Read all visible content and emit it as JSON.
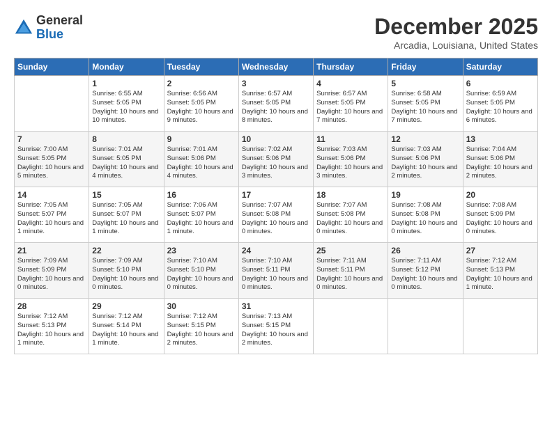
{
  "header": {
    "logo_general": "General",
    "logo_blue": "Blue",
    "month": "December 2025",
    "location": "Arcadia, Louisiana, United States"
  },
  "days_of_week": [
    "Sunday",
    "Monday",
    "Tuesday",
    "Wednesday",
    "Thursday",
    "Friday",
    "Saturday"
  ],
  "weeks": [
    [
      {
        "day": "",
        "empty": true
      },
      {
        "day": "1",
        "sunrise": "Sunrise: 6:55 AM",
        "sunset": "Sunset: 5:05 PM",
        "daylight": "Daylight: 10 hours and 10 minutes."
      },
      {
        "day": "2",
        "sunrise": "Sunrise: 6:56 AM",
        "sunset": "Sunset: 5:05 PM",
        "daylight": "Daylight: 10 hours and 9 minutes."
      },
      {
        "day": "3",
        "sunrise": "Sunrise: 6:57 AM",
        "sunset": "Sunset: 5:05 PM",
        "daylight": "Daylight: 10 hours and 8 minutes."
      },
      {
        "day": "4",
        "sunrise": "Sunrise: 6:57 AM",
        "sunset": "Sunset: 5:05 PM",
        "daylight": "Daylight: 10 hours and 7 minutes."
      },
      {
        "day": "5",
        "sunrise": "Sunrise: 6:58 AM",
        "sunset": "Sunset: 5:05 PM",
        "daylight": "Daylight: 10 hours and 7 minutes."
      },
      {
        "day": "6",
        "sunrise": "Sunrise: 6:59 AM",
        "sunset": "Sunset: 5:05 PM",
        "daylight": "Daylight: 10 hours and 6 minutes."
      }
    ],
    [
      {
        "day": "7",
        "sunrise": "Sunrise: 7:00 AM",
        "sunset": "Sunset: 5:05 PM",
        "daylight": "Daylight: 10 hours and 5 minutes."
      },
      {
        "day": "8",
        "sunrise": "Sunrise: 7:01 AM",
        "sunset": "Sunset: 5:05 PM",
        "daylight": "Daylight: 10 hours and 4 minutes."
      },
      {
        "day": "9",
        "sunrise": "Sunrise: 7:01 AM",
        "sunset": "Sunset: 5:06 PM",
        "daylight": "Daylight: 10 hours and 4 minutes."
      },
      {
        "day": "10",
        "sunrise": "Sunrise: 7:02 AM",
        "sunset": "Sunset: 5:06 PM",
        "daylight": "Daylight: 10 hours and 3 minutes."
      },
      {
        "day": "11",
        "sunrise": "Sunrise: 7:03 AM",
        "sunset": "Sunset: 5:06 PM",
        "daylight": "Daylight: 10 hours and 3 minutes."
      },
      {
        "day": "12",
        "sunrise": "Sunrise: 7:03 AM",
        "sunset": "Sunset: 5:06 PM",
        "daylight": "Daylight: 10 hours and 2 minutes."
      },
      {
        "day": "13",
        "sunrise": "Sunrise: 7:04 AM",
        "sunset": "Sunset: 5:06 PM",
        "daylight": "Daylight: 10 hours and 2 minutes."
      }
    ],
    [
      {
        "day": "14",
        "sunrise": "Sunrise: 7:05 AM",
        "sunset": "Sunset: 5:07 PM",
        "daylight": "Daylight: 10 hours and 1 minute."
      },
      {
        "day": "15",
        "sunrise": "Sunrise: 7:05 AM",
        "sunset": "Sunset: 5:07 PM",
        "daylight": "Daylight: 10 hours and 1 minute."
      },
      {
        "day": "16",
        "sunrise": "Sunrise: 7:06 AM",
        "sunset": "Sunset: 5:07 PM",
        "daylight": "Daylight: 10 hours and 1 minute."
      },
      {
        "day": "17",
        "sunrise": "Sunrise: 7:07 AM",
        "sunset": "Sunset: 5:08 PM",
        "daylight": "Daylight: 10 hours and 0 minutes."
      },
      {
        "day": "18",
        "sunrise": "Sunrise: 7:07 AM",
        "sunset": "Sunset: 5:08 PM",
        "daylight": "Daylight: 10 hours and 0 minutes."
      },
      {
        "day": "19",
        "sunrise": "Sunrise: 7:08 AM",
        "sunset": "Sunset: 5:08 PM",
        "daylight": "Daylight: 10 hours and 0 minutes."
      },
      {
        "day": "20",
        "sunrise": "Sunrise: 7:08 AM",
        "sunset": "Sunset: 5:09 PM",
        "daylight": "Daylight: 10 hours and 0 minutes."
      }
    ],
    [
      {
        "day": "21",
        "sunrise": "Sunrise: 7:09 AM",
        "sunset": "Sunset: 5:09 PM",
        "daylight": "Daylight: 10 hours and 0 minutes."
      },
      {
        "day": "22",
        "sunrise": "Sunrise: 7:09 AM",
        "sunset": "Sunset: 5:10 PM",
        "daylight": "Daylight: 10 hours and 0 minutes."
      },
      {
        "day": "23",
        "sunrise": "Sunrise: 7:10 AM",
        "sunset": "Sunset: 5:10 PM",
        "daylight": "Daylight: 10 hours and 0 minutes."
      },
      {
        "day": "24",
        "sunrise": "Sunrise: 7:10 AM",
        "sunset": "Sunset: 5:11 PM",
        "daylight": "Daylight: 10 hours and 0 minutes."
      },
      {
        "day": "25",
        "sunrise": "Sunrise: 7:11 AM",
        "sunset": "Sunset: 5:11 PM",
        "daylight": "Daylight: 10 hours and 0 minutes."
      },
      {
        "day": "26",
        "sunrise": "Sunrise: 7:11 AM",
        "sunset": "Sunset: 5:12 PM",
        "daylight": "Daylight: 10 hours and 0 minutes."
      },
      {
        "day": "27",
        "sunrise": "Sunrise: 7:12 AM",
        "sunset": "Sunset: 5:13 PM",
        "daylight": "Daylight: 10 hours and 1 minute."
      }
    ],
    [
      {
        "day": "28",
        "sunrise": "Sunrise: 7:12 AM",
        "sunset": "Sunset: 5:13 PM",
        "daylight": "Daylight: 10 hours and 1 minute."
      },
      {
        "day": "29",
        "sunrise": "Sunrise: 7:12 AM",
        "sunset": "Sunset: 5:14 PM",
        "daylight": "Daylight: 10 hours and 1 minute."
      },
      {
        "day": "30",
        "sunrise": "Sunrise: 7:12 AM",
        "sunset": "Sunset: 5:15 PM",
        "daylight": "Daylight: 10 hours and 2 minutes."
      },
      {
        "day": "31",
        "sunrise": "Sunrise: 7:13 AM",
        "sunset": "Sunset: 5:15 PM",
        "daylight": "Daylight: 10 hours and 2 minutes."
      },
      {
        "day": "",
        "empty": true
      },
      {
        "day": "",
        "empty": true
      },
      {
        "day": "",
        "empty": true
      }
    ]
  ]
}
